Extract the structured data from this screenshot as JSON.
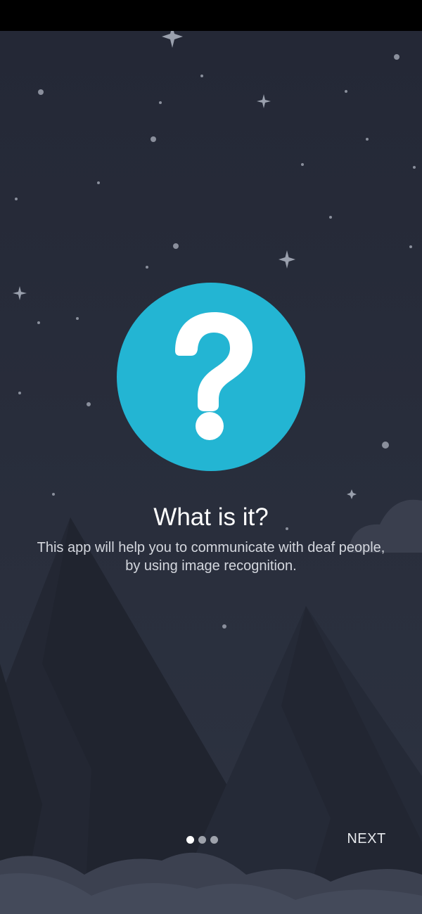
{
  "onboarding": {
    "title": "What is it?",
    "description": "This app will help you to communicate with deaf people, by using image recognition.",
    "hero_icon": "question-mark-icon",
    "pager": {
      "total_pages": 3,
      "current_page": 1
    },
    "next_label": "NEXT"
  },
  "colors": {
    "sky_top": "#252938",
    "sky_bottom": "#2c3240",
    "accent": "#23b5d3",
    "mountain": "#242834",
    "cloud": "#3f4454",
    "text_primary": "#ffffff",
    "text_secondary": "#d4d7de"
  }
}
